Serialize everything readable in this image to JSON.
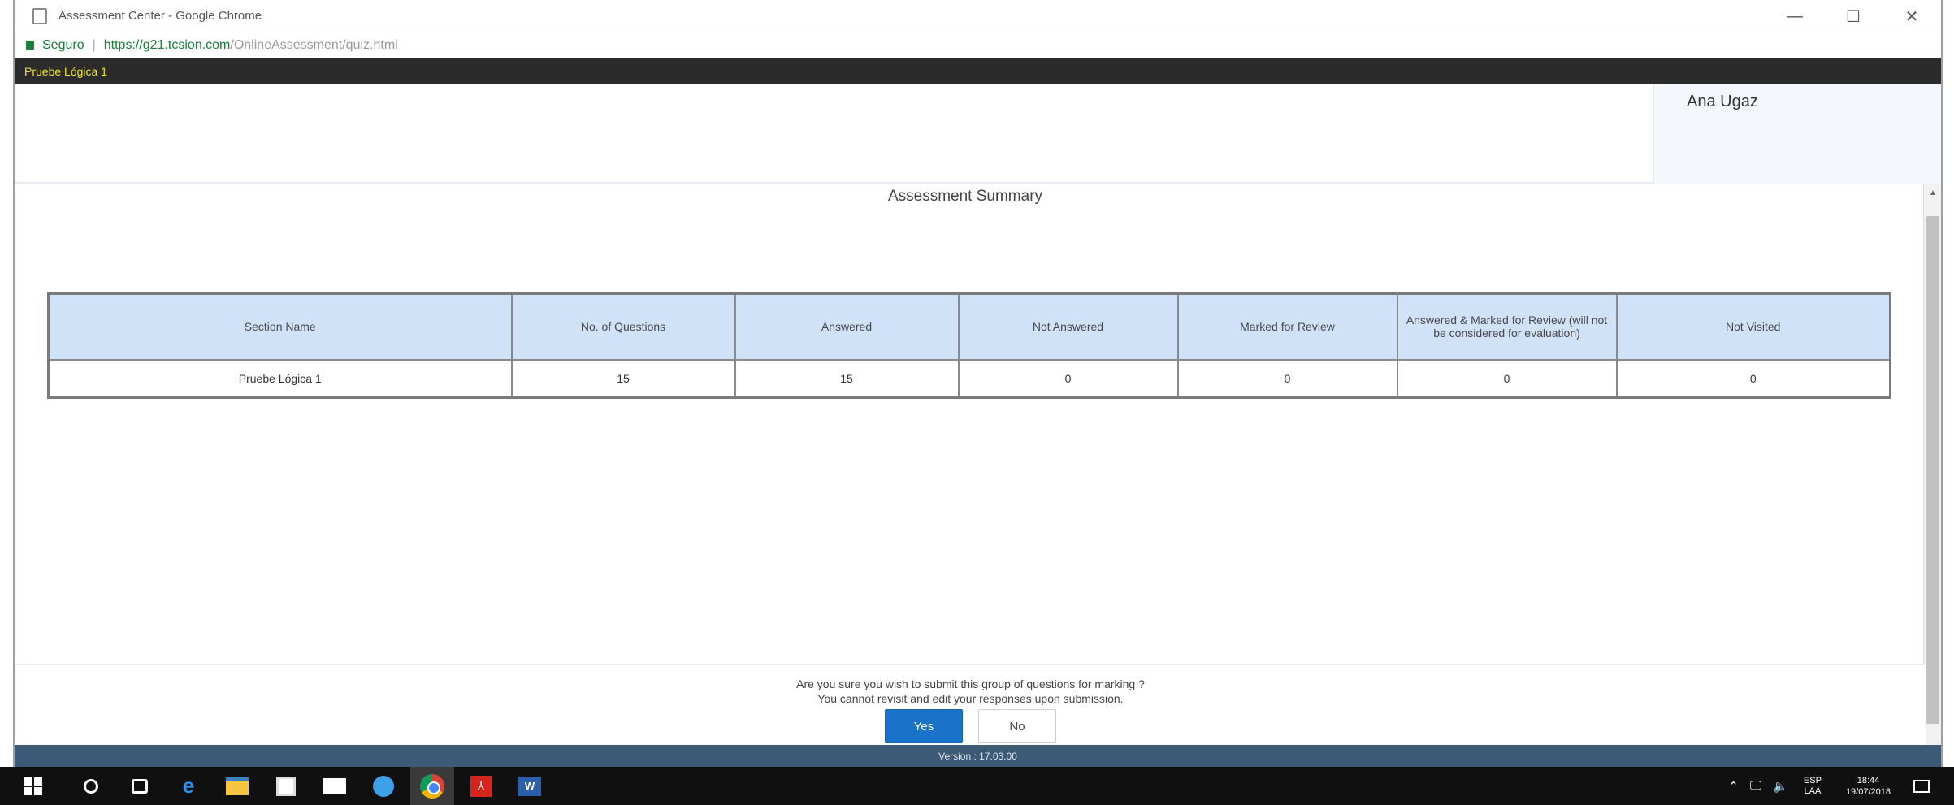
{
  "browser": {
    "title": "Assessment Center - Google Chrome",
    "secure_label": "Seguro",
    "url_host": "https://g21.tcsion.com",
    "url_path": "/OnlineAssessment/quiz.html",
    "minimize": "—",
    "maximize": "☐",
    "close": "✕"
  },
  "nav": {
    "section_title": "Pruebe Lógica 1"
  },
  "user": {
    "name": "Ana Ugaz"
  },
  "summary": {
    "title": "Assessment Summary",
    "columns": [
      "Section Name",
      "No. of Questions",
      "Answered",
      "Not Answered",
      "Marked for Review",
      "Answered & Marked for Review (will not be considered for evaluation)",
      "Not Visited"
    ],
    "rows": [
      [
        "Pruebe Lógica 1",
        "15",
        "15",
        "0",
        "0",
        "0",
        "0"
      ]
    ]
  },
  "confirm": {
    "line1": "Are you sure you wish to submit this group of questions for marking ?",
    "line2": "You cannot revisit and edit your responses upon submission.",
    "yes_label": "Yes",
    "no_label": "No"
  },
  "footer": {
    "version": "Version : 17.03.00"
  },
  "taskbar": {
    "lang_line1": "ESP",
    "lang_line2": "LAA",
    "time": "18:44",
    "date": "19/07/2018",
    "icons": [
      "windows-start-icon",
      "search-icon",
      "task-view-icon",
      "edge-icon",
      "file-explorer-icon",
      "store-icon",
      "mail-icon",
      "network-app-icon",
      "chrome-icon",
      "acrobat-icon",
      "word-icon"
    ]
  },
  "colors": {
    "nav_bg": "#2b2b2b",
    "nav_text": "#f0e32a",
    "table_header_bg": "#cfe2f8",
    "yes_button": "#1a73c8",
    "version_bar": "#3d5a76"
  }
}
